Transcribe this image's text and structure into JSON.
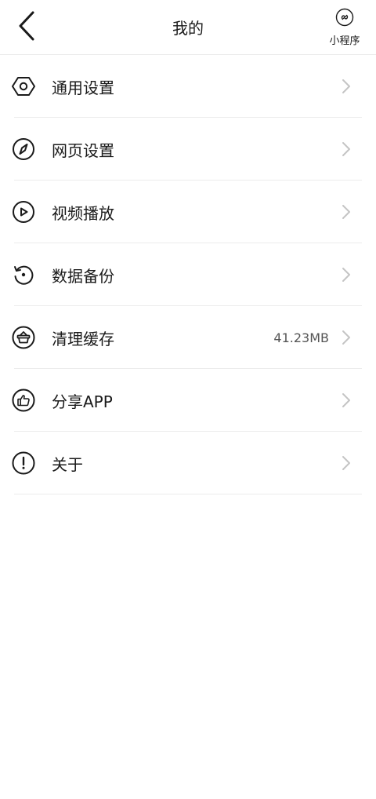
{
  "header": {
    "title": "我的",
    "mini_program_label": "小程序",
    "back_icon": "chevron-left-icon",
    "mini_program_icon": "link-circle-icon"
  },
  "menu": [
    {
      "key": "general",
      "label": "通用设置",
      "icon": "hexagon-settings-icon",
      "value": ""
    },
    {
      "key": "web",
      "label": "网页设置",
      "icon": "compass-icon",
      "value": ""
    },
    {
      "key": "video",
      "label": "视频播放",
      "icon": "play-circle-icon",
      "value": ""
    },
    {
      "key": "backup",
      "label": "数据备份",
      "icon": "restore-icon",
      "value": ""
    },
    {
      "key": "cache",
      "label": "清理缓存",
      "icon": "basket-clean-icon",
      "value": "41.23MB"
    },
    {
      "key": "share",
      "label": "分享APP",
      "icon": "thumbs-up-icon",
      "value": ""
    },
    {
      "key": "about",
      "label": "关于",
      "icon": "info-exclamation-icon",
      "value": ""
    }
  ],
  "colors": {
    "text": "#1a1a1a",
    "divider": "#ececec",
    "chevron": "#c4c4c4",
    "background": "#ffffff"
  }
}
